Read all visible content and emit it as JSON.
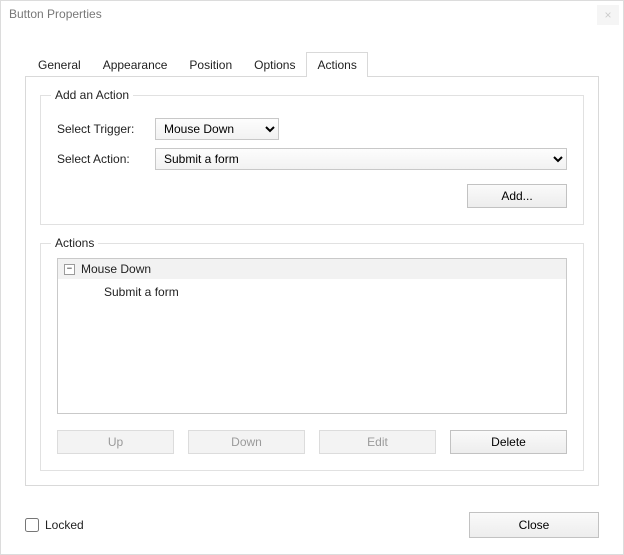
{
  "window": {
    "title": "Button Properties"
  },
  "tabs": [
    {
      "label": "General"
    },
    {
      "label": "Appearance"
    },
    {
      "label": "Position"
    },
    {
      "label": "Options"
    },
    {
      "label": "Actions"
    }
  ],
  "add_action": {
    "legend": "Add an Action",
    "trigger_label": "Select Trigger:",
    "trigger_value": "Mouse Down",
    "action_label": "Select Action:",
    "action_value": "Submit a form",
    "add_button": "Add..."
  },
  "actions_list": {
    "legend": "Actions",
    "trigger_node": "Mouse Down",
    "expander_glyph": "−",
    "action_node": "Submit a form",
    "buttons": {
      "up": "Up",
      "down": "Down",
      "edit": "Edit",
      "delete": "Delete"
    }
  },
  "footer": {
    "locked_label": "Locked",
    "close_button": "Close"
  }
}
